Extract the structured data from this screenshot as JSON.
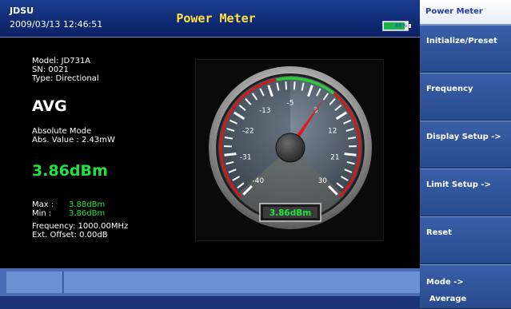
{
  "header": {
    "brand": "JDSU",
    "datetime": "2009/03/13 12:46:51",
    "title": "Power Meter",
    "battery": {
      "label": "88%",
      "level": 0.88
    }
  },
  "info": {
    "model": "Model: JD731A",
    "sn": "SN: 0021",
    "type": "Type: Directional",
    "avg": "AVG",
    "mode": "Absolute Mode",
    "abs_value": "Abs. Value : 2.43mW",
    "reading": "3.86dBm",
    "max_label": "Max :",
    "max_value": "3.88dBm",
    "min_label": "Min :",
    "min_value": "3.86dBm",
    "frequency": "Frequency: 1000.00MHz",
    "ext_offset": "Ext. Offset: 0.00dB"
  },
  "gauge": {
    "tick_labels": [
      "-40",
      "-31",
      "-22",
      "-13",
      "-5",
      "3",
      "12",
      "21",
      "30"
    ],
    "range": [
      -40,
      30
    ],
    "value": 3.86,
    "readout": "3.86dBm",
    "colors": {
      "needle": "#e01818",
      "red_zone": "#d41818",
      "green_zone": "#2acc3a"
    }
  },
  "softkeys": {
    "header": "Power Meter",
    "items": [
      {
        "label": "Initialize/Preset"
      },
      {
        "label": "Frequency"
      },
      {
        "label": "Display Setup ->"
      },
      {
        "label": "Limit Setup ->"
      },
      {
        "label": "Reset"
      },
      {
        "label": "Mode ->",
        "sub": "Average"
      }
    ]
  }
}
